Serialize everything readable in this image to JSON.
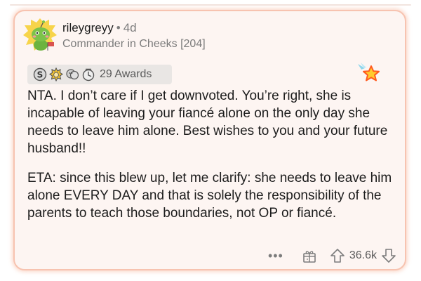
{
  "comment": {
    "username": "rileygreyy",
    "separator": "•",
    "age": "4d",
    "flair": "Commander in Cheeks [204]",
    "awards_count": "29 Awards",
    "paragraphs": [
      "NTA. I don’t care if I get downvoted. You’re right, she is incapable of leaving your fiancé alone on the only day she needs to leave him alone. Best wishes to you and your future husband!!",
      "ETA: since this blew up, let me clarify: she needs to leave him alone EVERY DAY and that is solely the responsibility of the parents to teach those boundaries, not OP or fiancé."
    ],
    "more_label": "•••",
    "score": "36.6k"
  },
  "icons": {
    "avatar": "snoo-avatar-green",
    "award_icons": [
      "silver-award-icon",
      "gold-award-icon",
      "hugz-award-icon",
      "timer-award-icon"
    ],
    "star": "give-award-star-icon",
    "gift": "gift-icon",
    "upvote": "upvote-arrow-icon",
    "downvote": "downvote-arrow-icon"
  },
  "colors": {
    "card_background": "#fdf5f2",
    "card_border": "#f7c3b0",
    "text": "#1c1c1c",
    "meta_text": "#7c7c7c"
  }
}
